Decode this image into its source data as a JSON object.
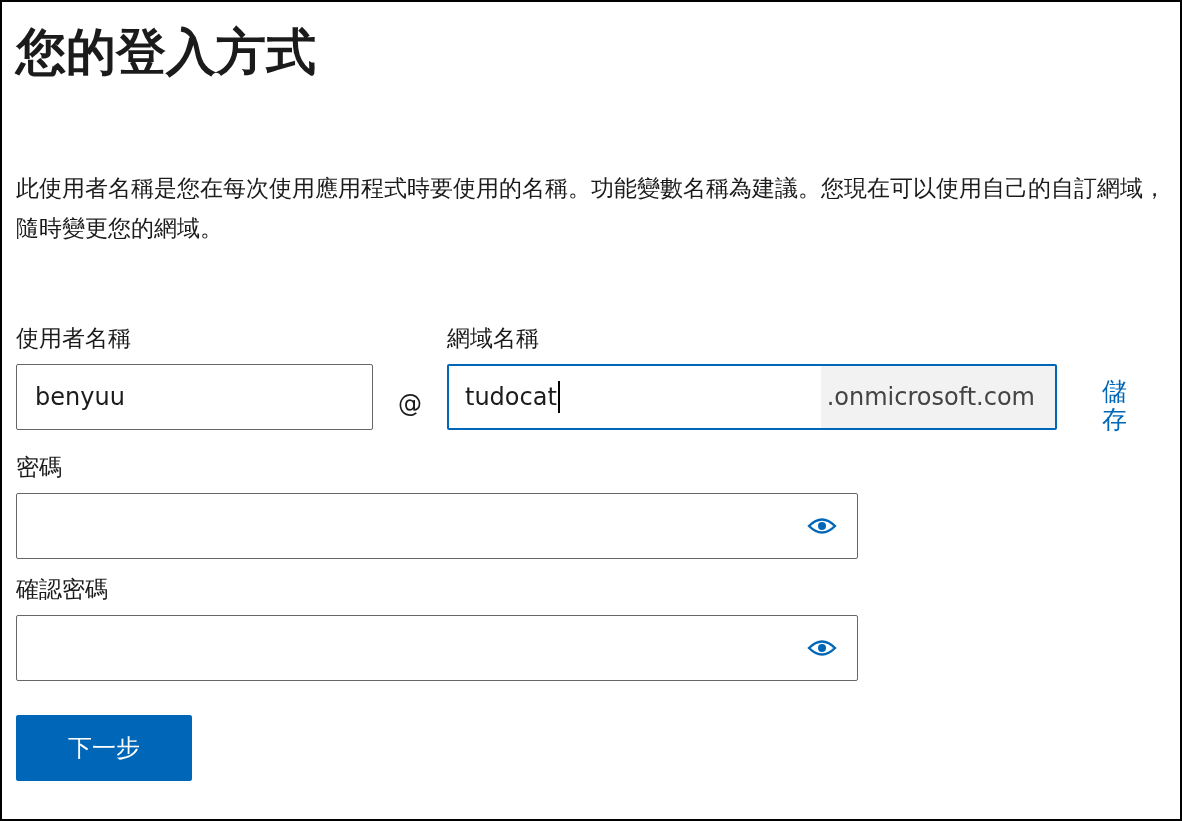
{
  "title": "您的登入方式",
  "description": "此使用者名稱是您在每次使用應用程式時要使用的名稱。功能變數名稱為建議。您現在可以使用自己的自訂網域，隨時變更您的網域。",
  "username": {
    "label": "使用者名稱",
    "value": "benyuu"
  },
  "at_sign": "@",
  "domain": {
    "label": "網域名稱",
    "value": "tudocat",
    "suffix": ".onmicrosoft.com",
    "focused": true
  },
  "save_link": "儲存",
  "password_fields": [
    {
      "label": "密碼"
    },
    {
      "label": "確認密碼"
    }
  ],
  "next_button": "下一步"
}
